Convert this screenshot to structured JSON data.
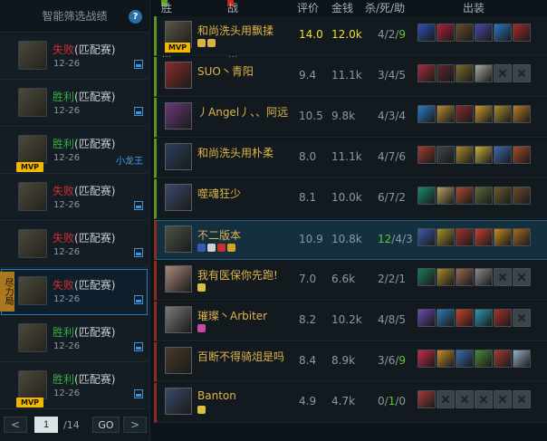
{
  "sidebar": {
    "title": "智能筛选战绩",
    "help": "?",
    "matches": [
      {
        "result": "失败",
        "mode": "(匹配赛)",
        "date": "12-26",
        "tag": "",
        "mvp": false,
        "selected": false,
        "forfeit": ""
      },
      {
        "result": "胜利",
        "mode": "(匹配赛)",
        "date": "12-26",
        "tag": "",
        "mvp": false,
        "selected": false,
        "forfeit": ""
      },
      {
        "result": "胜利",
        "mode": "(匹配赛)",
        "date": "12-26",
        "tag": "小龙王",
        "mvp": true,
        "selected": false,
        "forfeit": ""
      },
      {
        "result": "失败",
        "mode": "(匹配赛)",
        "date": "12-26",
        "tag": "",
        "mvp": false,
        "selected": false,
        "forfeit": ""
      },
      {
        "result": "失败",
        "mode": "(匹配赛)",
        "date": "12-26",
        "tag": "",
        "mvp": false,
        "selected": false,
        "forfeit": ""
      },
      {
        "result": "失败",
        "mode": "(匹配赛)",
        "date": "12-26",
        "tag": "",
        "mvp": false,
        "selected": true,
        "forfeit": "尽力局"
      },
      {
        "result": "胜利",
        "mode": "(匹配赛)",
        "date": "12-26",
        "tag": "",
        "mvp": false,
        "selected": false,
        "forfeit": ""
      },
      {
        "result": "胜利",
        "mode": "(匹配赛)",
        "date": "12-26",
        "tag": "",
        "mvp": true,
        "selected": false,
        "forfeit": ""
      }
    ],
    "pager": {
      "prev": "<",
      "page": "1",
      "total": "/14",
      "go": "GO",
      "next": ">"
    }
  },
  "table": {
    "headers": {
      "win_team": "胜利队伍",
      "lose_team": "战败队伍",
      "score": "评价",
      "gold": "金钱",
      "kda": "杀/死/助",
      "items": "出装"
    },
    "colors": {
      "win": "#5aa61e",
      "lose": "#c7271b"
    },
    "players": [
      {
        "name": "和尚洗头用飘揉",
        "team": "win",
        "score": "14.0",
        "gold": "12.0k",
        "kda": [
          "4",
          "2",
          "9"
        ],
        "kda_hi": 2,
        "mvp": true,
        "best": true,
        "highlight": false,
        "avatar_color": "#5b5745",
        "badges": [
          "#d8b341",
          "#d8b341"
        ],
        "items": [
          "#2a4fb8",
          "#b0203a",
          "#6c4a2c",
          "#4a46a8",
          "#2a78c4",
          "#a52a2a"
        ]
      },
      {
        "name": "SUO丶青阳",
        "team": "win",
        "score": "9.4",
        "gold": "11.1k",
        "kda": [
          "3",
          "4",
          "5"
        ],
        "kda_hi": -1,
        "mvp": false,
        "best": false,
        "highlight": false,
        "avatar_color": "#8a2d2a",
        "badges": [],
        "items": [
          "#a52c3c",
          "#5c2a2a",
          "#7c6e2a",
          "#aaa9a0",
          "",
          ""
        ]
      },
      {
        "name": "丿Angel丿、、阿远",
        "team": "win",
        "score": "10.5",
        "gold": "9.8k",
        "kda": [
          "4",
          "3",
          "4"
        ],
        "kda_hi": -1,
        "mvp": false,
        "best": false,
        "highlight": false,
        "avatar_color": "#6a3a7a",
        "badges": [],
        "items": [
          "#2a7cc8",
          "#b88a30",
          "#8a2a2a",
          "#c99a2a",
          "#a88a2a",
          "#b87a20"
        ]
      },
      {
        "name": "和尚洗头用朴柔",
        "team": "win",
        "score": "8.0",
        "gold": "11.1k",
        "kda": [
          "4",
          "7",
          "6"
        ],
        "kda_hi": -1,
        "mvp": false,
        "best": false,
        "highlight": false,
        "avatar_color": "#2c3f5e",
        "badges": [],
        "items": [
          "#a43a2a",
          "#444444",
          "#a88a2a",
          "#c9b03a",
          "#3a6ab0",
          "#a84a2a"
        ]
      },
      {
        "name": "噬魂狂少",
        "team": "win",
        "score": "8.1",
        "gold": "10.0k",
        "kda": [
          "6",
          "7",
          "2"
        ],
        "kda_hi": -1,
        "mvp": false,
        "best": false,
        "highlight": false,
        "avatar_color": "#3a4a6a",
        "badges": [],
        "items": [
          "#1a8a6a",
          "#b8a060",
          "#a84a2a",
          "#5a6a3a",
          "#6a5a2a",
          "#6a4a2a"
        ]
      },
      {
        "name": "不二版本",
        "team": "lose",
        "score": "10.9",
        "gold": "10.8k",
        "kda": [
          "12",
          "4",
          "3"
        ],
        "kda_hi": 0,
        "mvp": false,
        "best": false,
        "highlight": true,
        "avatar_color": "#4a5444",
        "badges": [
          "#3a5ab0",
          "#d0d0d0",
          "#c8302a",
          "#d8a020"
        ],
        "items": [
          "#3a5ab0",
          "#a8902a",
          "#a8302a",
          "#c8402a",
          "#c88a20",
          "#a86a20"
        ]
      },
      {
        "name": "我有医保你先跑!",
        "team": "lose",
        "score": "7.0",
        "gold": "6.6k",
        "kda": [
          "2",
          "2",
          "1"
        ],
        "kda_hi": -1,
        "mvp": false,
        "best": false,
        "highlight": false,
        "avatar_color": "#a88a7a",
        "badges": [
          "#d8c040"
        ],
        "items": [
          "#1a7a5a",
          "#a88a2a",
          "#9a6a4a",
          "#8a8a8a",
          "",
          ""
        ]
      },
      {
        "name": "璀璨丶Arbiter",
        "team": "lose",
        "score": "8.2",
        "gold": "10.2k",
        "kda": [
          "4",
          "8",
          "5"
        ],
        "kda_hi": -1,
        "mvp": false,
        "best": false,
        "highlight": false,
        "avatar_color": "#7a7a7a",
        "badges": [
          "#c84aa0"
        ],
        "items": [
          "#6a4ab0",
          "#2a7ab8",
          "#c8402a",
          "#2a9ab0",
          "#a8302a",
          ""
        ]
      },
      {
        "name": "百断不得骑俎是吗",
        "team": "lose",
        "score": "8.4",
        "gold": "8.9k",
        "kda": [
          "3",
          "6",
          "9"
        ],
        "kda_hi": 2,
        "mvp": false,
        "best": false,
        "highlight": false,
        "avatar_color": "#4a3a2a",
        "badges": [],
        "items": [
          "#c82a4a",
          "#c88a2a",
          "#3a6ab0",
          "#4a8a3a",
          "#a83a2a",
          "#9ab0c8"
        ]
      },
      {
        "name": "Banton",
        "team": "lose",
        "score": "4.9",
        "gold": "4.7k",
        "kda": [
          "0",
          "1",
          "0"
        ],
        "kda_hi": 1,
        "mvp": false,
        "best": false,
        "highlight": false,
        "avatar_color": "#3a4a6a",
        "badges": [
          "#d8c040"
        ],
        "items": [
          "#a83a3a",
          "",
          "",
          "",
          "",
          ""
        ]
      }
    ]
  }
}
